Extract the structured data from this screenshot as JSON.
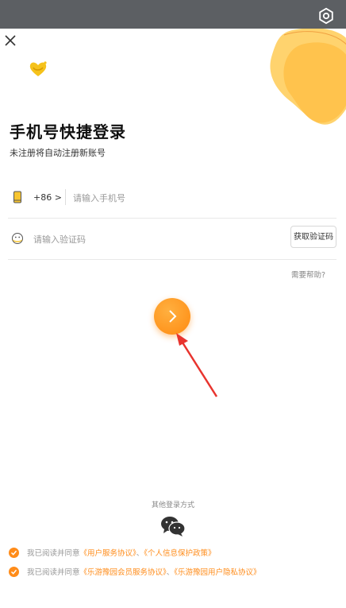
{
  "header": {
    "settings_icon": "gear-icon"
  },
  "sheet": {
    "close_icon": "close-icon",
    "title": "手机号快捷登录",
    "subtitle": "未注册将自动注册新账号"
  },
  "phone": {
    "country_code": "+86 >",
    "placeholder": "请输入手机号"
  },
  "code": {
    "placeholder": "请输入验证码",
    "get_code_label": "获取验证码"
  },
  "help_label": "需要帮助?",
  "other_login_label": "其他登录方式",
  "agreements": [
    {
      "prefix": "我已阅读并同意",
      "link1": "《用户服务协议》",
      "sep": "、",
      "link2": "《个人信息保护政策》"
    },
    {
      "prefix": "我已阅读并同意",
      "link1": "《乐游豫园会员服务协议》",
      "sep": "、",
      "link2": "《乐游豫园用户隐私协议》"
    }
  ],
  "colors": {
    "accent": "#ff8c1a",
    "topbar": "#5c5f63"
  }
}
